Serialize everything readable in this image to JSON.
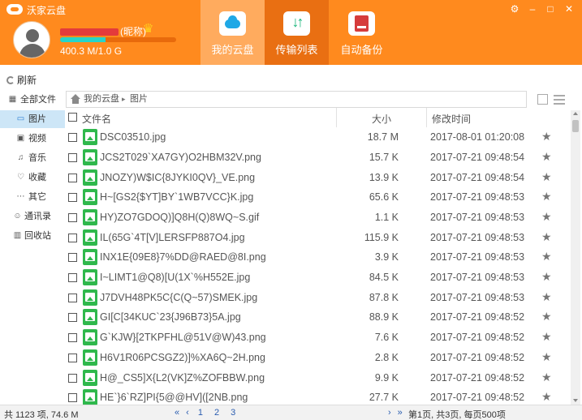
{
  "header": {
    "app_title": "沃家云盘",
    "nickname_suffix": "(昵称)",
    "quota_text": "400.3 M/1.0 G",
    "quota_fraction": 0.39,
    "tabs": [
      {
        "label": "我的云盘",
        "icon": "cloud-icon"
      },
      {
        "label": "传输列表",
        "icon": "transfer-icon"
      },
      {
        "label": "自动备份",
        "icon": "backup-icon"
      }
    ],
    "window_buttons": {
      "settings": "⚙",
      "minimize": "–",
      "maximize": "□",
      "close": "✕"
    },
    "crown": "♛"
  },
  "toolbar": {
    "refresh_label": "刷新"
  },
  "sidebar": {
    "items": [
      {
        "label": "全部文件",
        "icon": "grid-icon",
        "glyph": "▦"
      },
      {
        "label": "图片",
        "icon": "image-icon",
        "glyph": "▭"
      },
      {
        "label": "视频",
        "icon": "video-icon",
        "glyph": "▣"
      },
      {
        "label": "音乐",
        "icon": "music-icon",
        "glyph": "♫"
      },
      {
        "label": "收藏",
        "icon": "heart-icon",
        "glyph": "♡"
      },
      {
        "label": "其它",
        "icon": "more-icon",
        "glyph": "⋯"
      },
      {
        "label": "通讯录",
        "icon": "contacts-icon",
        "glyph": "☺"
      },
      {
        "label": "回收站",
        "icon": "trash-icon",
        "glyph": "▥"
      }
    ]
  },
  "breadcrumb": {
    "root": "我的云盘",
    "separator": "▸",
    "current": "图片"
  },
  "columns": {
    "name": "文件名",
    "size": "大小",
    "time": "修改时间"
  },
  "files": [
    {
      "name": "DSC03510.jpg",
      "size": "18.7 M",
      "time": "2017-08-01 01:20:08"
    },
    {
      "name": "JCS2T029`XA7GY)O2HBM32V.png",
      "size": "15.7 K",
      "time": "2017-07-21 09:48:54"
    },
    {
      "name": "JNOZY)W$IC{8JYKI0QV}_VE.png",
      "size": "13.9 K",
      "time": "2017-07-21 09:48:54"
    },
    {
      "name": "H~[GS2{$YT]BY`1WB7VCC}K.jpg",
      "size": "65.6 K",
      "time": "2017-07-21 09:48:53"
    },
    {
      "name": "HY)ZO7GDOQ)]Q8H(Q)8WQ~S.gif",
      "size": "1.1 K",
      "time": "2017-07-21 09:48:53"
    },
    {
      "name": "IL(65G`4T[V]LERSFP887O4.jpg",
      "size": "115.9 K",
      "time": "2017-07-21 09:48:53"
    },
    {
      "name": "INX1E{09E8}7%DD@RAED@8I.png",
      "size": "3.9 K",
      "time": "2017-07-21 09:48:53"
    },
    {
      "name": "I~LIMT1@Q8)[U(1X`%H552E.jpg",
      "size": "84.5 K",
      "time": "2017-07-21 09:48:53"
    },
    {
      "name": "J7DVH48PK5C{C(Q~57)SMEK.jpg",
      "size": "87.8 K",
      "time": "2017-07-21 09:48:53"
    },
    {
      "name": "GI[C[34KUC`23{J96B73}5A.jpg",
      "size": "88.9 K",
      "time": "2017-07-21 09:48:52"
    },
    {
      "name": "G`KJW}[2TKPFHL@51V@W)43.png",
      "size": "7.6 K",
      "time": "2017-07-21 09:48:52"
    },
    {
      "name": "H6V1R06PCSGZ2)]%XA6Q~2H.png",
      "size": "2.8 K",
      "time": "2017-07-21 09:48:52"
    },
    {
      "name": "H@_CS5]X{L2(VK]Z%ZOFBBW.png",
      "size": "9.9 K",
      "time": "2017-07-21 09:48:52"
    },
    {
      "name": "HE`}6`RZ]PI{5@@HV]([2NB.png",
      "size": "27.7 K",
      "time": "2017-07-21 09:48:52"
    }
  ],
  "status": {
    "summary": "共 1123 项, 74.6 M",
    "pager_prev": [
      "«",
      "‹"
    ],
    "pages": [
      "1",
      "2",
      "3"
    ],
    "pager_next": [
      "›",
      "»"
    ],
    "page_info": "第1页, 共3页, 每页500项"
  }
}
